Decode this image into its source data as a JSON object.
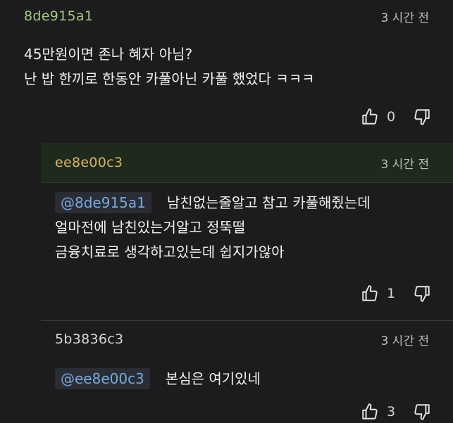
{
  "comments": [
    {
      "username": "8de915a1",
      "username_color": "#a7c97d",
      "time": "3 시간 전",
      "lines": [
        "45만원이면 존나 혜자 아님?",
        "난 밥 한끼로 한동안 카풀아닌 카풀 했었다 ㅋㅋㅋ"
      ],
      "likes": "0",
      "like_icon": "thumbs-up-icon",
      "dislike_icon": "thumbs-down-icon"
    },
    {
      "username": "ee8e00c3",
      "username_color": "#d8b55a",
      "header_bg": "#1f2a1c",
      "time": "3 시간 전",
      "mention": "@8de915a1",
      "first_line": "남친없는줄알고 참고 카풀해줬는데",
      "lines": [
        "얼마전에 남친있는거알고 정뚝떨",
        "금융치료로 생각하고있는데 쉽지가않아"
      ],
      "likes": "1"
    },
    {
      "username": "5b3836c3",
      "username_color": "#d8d8d8",
      "time": "3 시간 전",
      "mention": "@ee8e00c3",
      "first_line": "본심은 여기있네",
      "likes": "3"
    }
  ]
}
